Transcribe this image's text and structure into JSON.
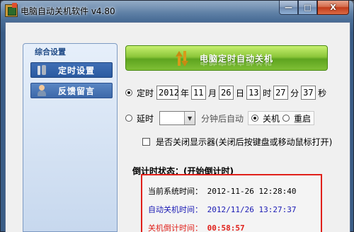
{
  "window": {
    "title": "电脑自动关机软件 v4.80",
    "min_symbol": "—",
    "max_symbol": "□",
    "close_symbol": "X"
  },
  "sidebar": {
    "header": "综合设置",
    "items": [
      {
        "label": "定时设置",
        "icon": "tools-icon"
      },
      {
        "label": "反馈留言",
        "icon": "user-icon"
      }
    ]
  },
  "banner": {
    "title": "电脑定时自动关机"
  },
  "timed": {
    "label": "定时",
    "year": "2012",
    "year_unit": "年",
    "month": "11",
    "month_unit": "月",
    "day": "26",
    "day_unit": "日",
    "hour": "13",
    "hour_unit": "时",
    "minute": "27",
    "minute_unit": "分",
    "second": "37",
    "second_unit": "秒"
  },
  "delay": {
    "label": "延时",
    "select_value": "",
    "after_text": "分钟后自动",
    "action_shutdown": "关机",
    "action_restart": "重启"
  },
  "monitor_option": {
    "label": "是否关闭显示器(关闭后按键盘或移动鼠标打开)"
  },
  "countdown": {
    "status_label": "倒计时状态：(开始倒计时)",
    "current_label": "当前系统时间：",
    "current_value": "2012-11-26 12:28:40",
    "auto_label": "自动关机时间：",
    "auto_value": "2012/11/26 13:27:37",
    "remaining_label": "关机倒计时间：",
    "remaining_value": "00:58:57"
  },
  "colors": {
    "accent_red": "#e0201a",
    "auto_blue": "#1a1ab4",
    "banner_green": "#7fbf35"
  }
}
